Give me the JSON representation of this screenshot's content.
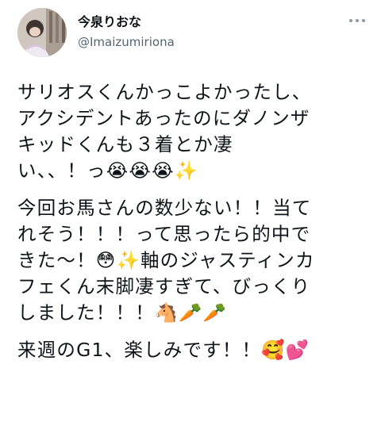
{
  "tweet": {
    "author": {
      "display_name": "今泉りおな",
      "handle": "@Imaizumiriona"
    },
    "more_icon": "more-horizontal-icon",
    "paragraphs": [
      {
        "lines": [
          "サリオスくんかっこよかったし、",
          "アクシデントあったのにダノンザ",
          "キッドくんも３着とか凄",
          "い、、！っ😭😭😭✨"
        ]
      },
      {
        "lines": [
          "今回お馬さんの数少ない！！当て",
          "れそう！！！って思ったら的中で",
          "きた〜！😳✨軸のジャスティンカ",
          "フェくん末脚凄すぎて、びっくり",
          "しました！！！🐴🥕🥕"
        ]
      },
      {
        "lines": [
          "来週のG1、楽しみです！！🥰💕"
        ]
      }
    ]
  }
}
